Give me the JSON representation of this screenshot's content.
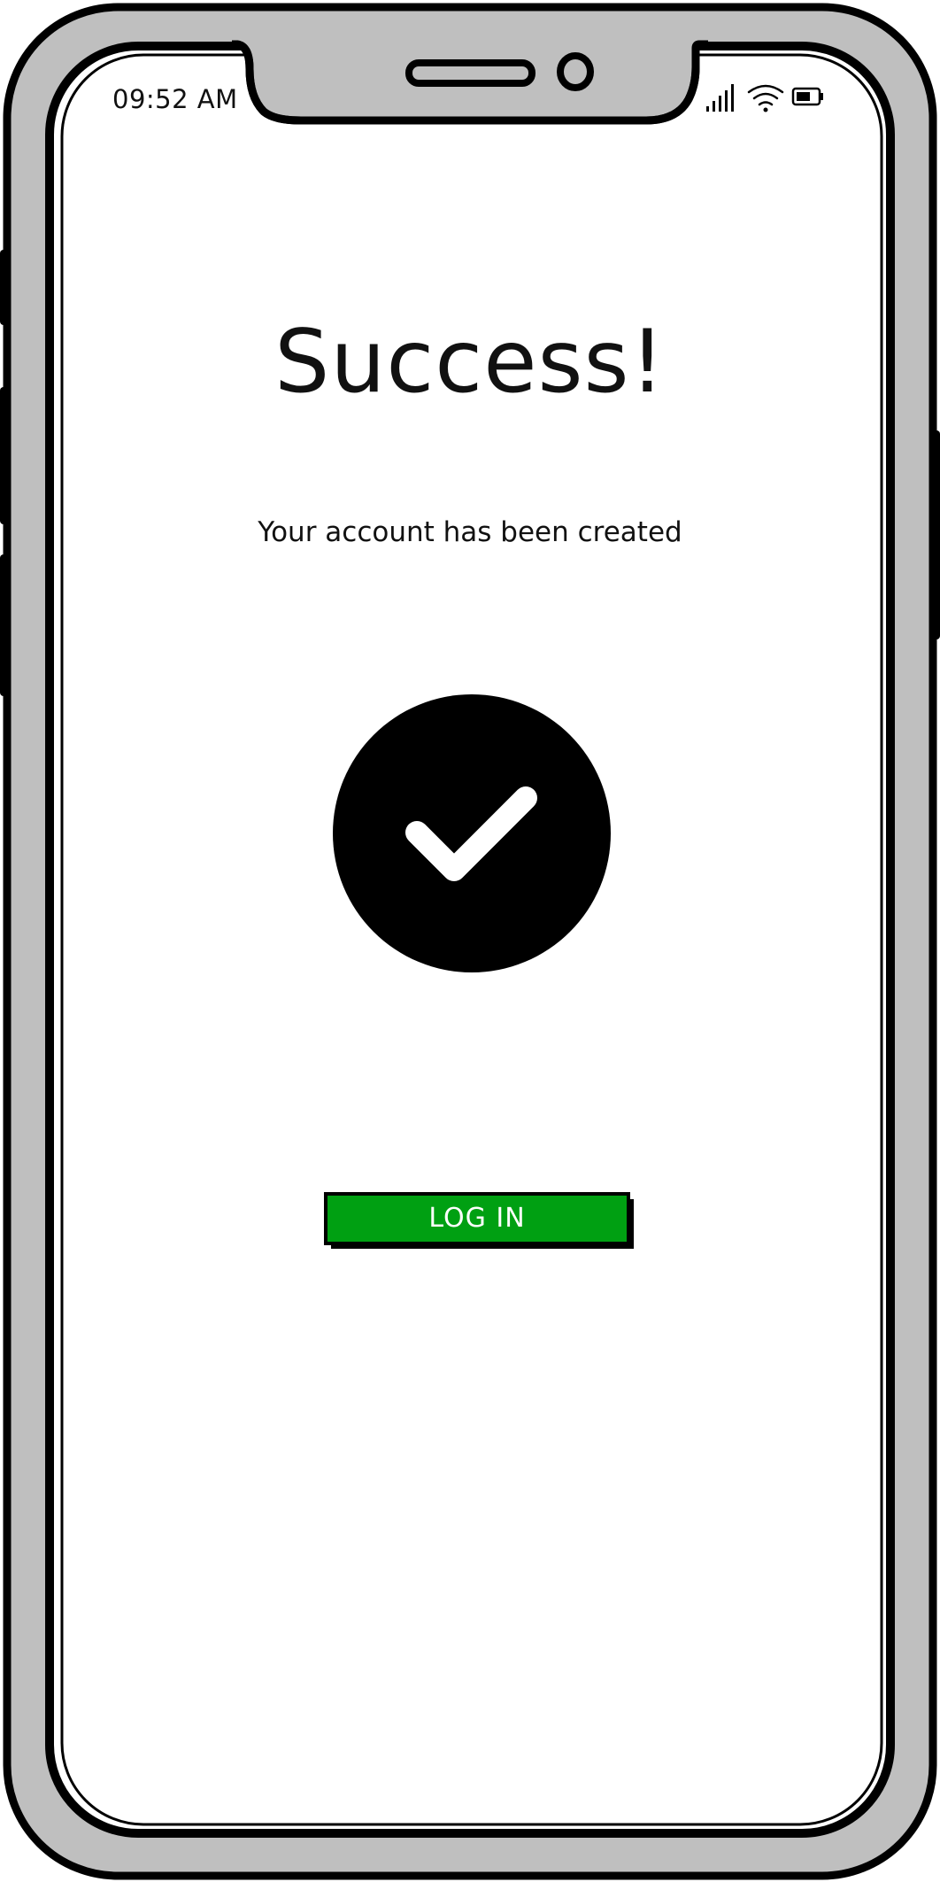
{
  "status_bar": {
    "time": "09:52 AM",
    "icons": [
      "signal-icon",
      "wifi-icon",
      "battery-icon"
    ]
  },
  "screen": {
    "title": "Success!",
    "message": "Your account has been created",
    "status_icon": "checkmark-icon"
  },
  "actions": {
    "login_label": "LOG IN"
  },
  "colors": {
    "phone_frame": "#bfbfbf",
    "outline": "#000000",
    "screen_bg": "#ffffff",
    "button_bg": "#00a012",
    "button_text": "#ffffff"
  }
}
